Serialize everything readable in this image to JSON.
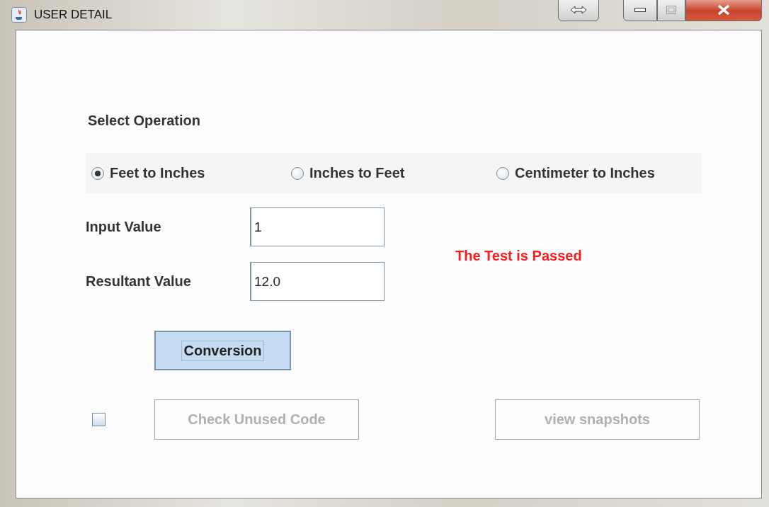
{
  "window": {
    "title": "USER DETAIL"
  },
  "section_label": "Select Operation",
  "operations": [
    {
      "label": "Feet to Inches",
      "selected": true
    },
    {
      "label": "Inches to Feet",
      "selected": false
    },
    {
      "label": "Centimeter to Inches",
      "selected": false
    }
  ],
  "fields": [
    {
      "label": "Input Value",
      "value": "1"
    },
    {
      "label": "Resultant Value",
      "value": "12.0"
    }
  ],
  "message": "The Test is Passed",
  "convert_button": {
    "label": "Conversion",
    "focused": true
  },
  "checkbox": {
    "checked": false
  },
  "buttons": [
    {
      "label": "Check Unused Code",
      "disabled": true
    },
    {
      "label": "view snapshots",
      "disabled": true
    }
  ]
}
